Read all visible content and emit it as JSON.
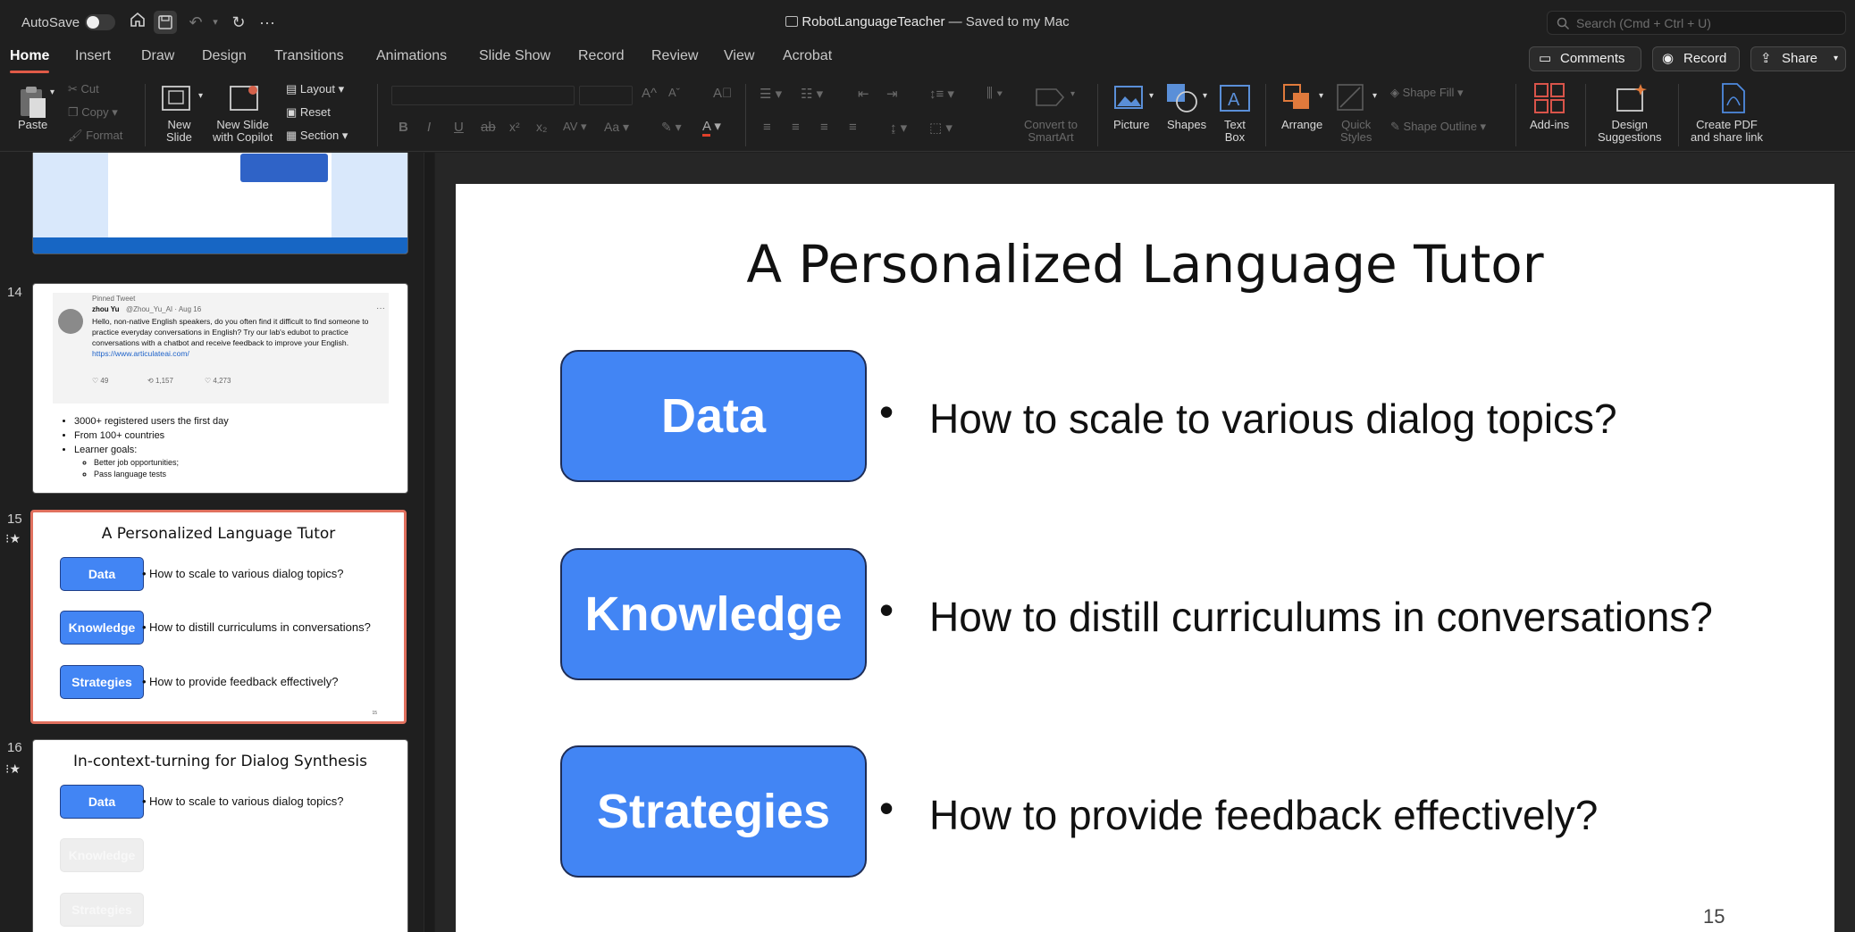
{
  "titlebar": {
    "autosave_label": "AutoSave",
    "doc_name": "RobotLanguageTeacher",
    "doc_status": "— Saved to my Mac",
    "search_placeholder": "Search (Cmd + Ctrl + U)"
  },
  "tabs": [
    "Home",
    "Insert",
    "Draw",
    "Design",
    "Transitions",
    "Animations",
    "Slide Show",
    "Record",
    "Review",
    "View",
    "Acrobat"
  ],
  "actions": {
    "comments": "Comments",
    "record": "Record",
    "share": "Share"
  },
  "ribbon": {
    "paste": "Paste",
    "cut": "Cut",
    "copy": "Copy",
    "format": "Format",
    "new_slide": "New\nSlide",
    "new_slide_copilot": "New Slide\nwith Copilot",
    "layout": "Layout",
    "reset": "Reset",
    "section": "Section",
    "convert_smartart": "Convert to\nSmartArt",
    "picture": "Picture",
    "shapes": "Shapes",
    "text_box": "Text\nBox",
    "arrange": "Arrange",
    "quick_styles": "Quick\nStyles",
    "shape_fill": "Shape Fill",
    "shape_outline": "Shape Outline",
    "add_ins": "Add-ins",
    "design_suggestions": "Design\nSuggestions",
    "create_pdf": "Create PDF\nand share link"
  },
  "thumbnails": {
    "slide14": {
      "number": "14",
      "tweet_pinned": "Pinned Tweet",
      "tweet_author": "zhou Yu",
      "tweet_handle": "@Zhou_Yu_AI · Aug 16",
      "tweet_text": "Hello, non-native English speakers, do you often find it difficult to find someone to practice everyday conversations in English? Try our lab's edubot to practice conversations with a chatbot and receive feedback to improve your English.",
      "tweet_link": "https://www.articulateai.com/",
      "tweet_stats": [
        "49",
        "1,157",
        "4,273"
      ],
      "bullets": [
        "3000+ registered users the first day",
        "From 100+ countries",
        "Learner goals:"
      ],
      "sub_bullets": [
        "Better job opportunities;",
        "Pass language tests"
      ]
    },
    "slide15": {
      "number": "15",
      "title": "A Personalized Language Tutor",
      "boxes": [
        "Data",
        "Knowledge",
        "Strategies"
      ],
      "bullets": [
        "How to scale to various dialog topics?",
        "How to distill curriculums in conversations?",
        "How to provide feedback effectively?"
      ],
      "page": "15"
    },
    "slide16": {
      "number": "16",
      "title": "In-context-turning for Dialog Synthesis",
      "boxes": [
        "Data",
        "Knowledge",
        "Strategies"
      ],
      "bullets": [
        "How to scale to various dialog topics?"
      ]
    }
  },
  "slide": {
    "title": "A Personalized Language Tutor",
    "rows": [
      {
        "label": "Data",
        "bullet": "How to scale to various dialog topics?"
      },
      {
        "label": "Knowledge",
        "bullet": "How to distill curriculums in conversations?"
      },
      {
        "label": "Strategies",
        "bullet": "How to provide feedback effectively?"
      }
    ],
    "page_number": "15"
  },
  "colors": {
    "accent_tab": "#e05a47",
    "box_blue": "#4285f4",
    "selected_outline": "#e0705e"
  }
}
